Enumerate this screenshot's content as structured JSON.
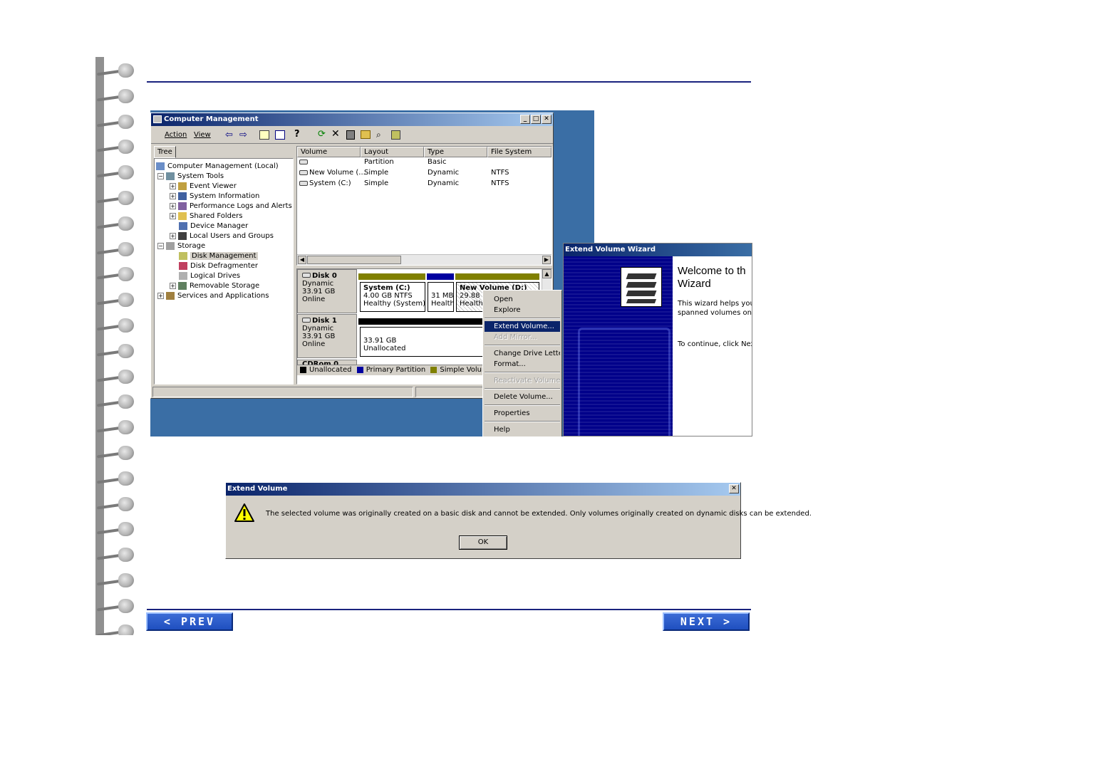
{
  "nav": {
    "prev_label": "< PREV",
    "next_label": "NEXT >"
  },
  "computer_management": {
    "title": "Computer Management",
    "menu": [
      "Action",
      "View"
    ],
    "tree_tab": "Tree",
    "tree": [
      "Computer Management (Local)",
      "System Tools",
      "Event Viewer",
      "System Information",
      "Performance Logs and Alerts",
      "Shared Folders",
      "Device Manager",
      "Local Users and Groups",
      "Storage",
      "Disk Management",
      "Disk Defragmenter",
      "Logical Drives",
      "Removable Storage",
      "Services and Applications"
    ],
    "columns": [
      "Volume",
      "Layout",
      "Type",
      "File System"
    ],
    "volumes": [
      {
        "volume": "",
        "layout": "Partition",
        "type": "Basic",
        "fs": ""
      },
      {
        "volume": "New Volume (...",
        "layout": "Simple",
        "type": "Dynamic",
        "fs": "NTFS"
      },
      {
        "volume": "System (C:)",
        "layout": "Simple",
        "type": "Dynamic",
        "fs": "NTFS"
      }
    ],
    "disk0": {
      "name": "Disk 0",
      "kind": "Dynamic",
      "size": "33.91 GB",
      "status": "Online",
      "p1": {
        "name": "System (C:)",
        "size": "4.00 GB NTFS",
        "status": "Healthy (System)"
      },
      "p2": {
        "size": "31 MB",
        "status": "Health"
      },
      "p3": {
        "name": "New Volume (D:)",
        "size": "29.88 G",
        "status": "Healthy"
      }
    },
    "disk1": {
      "name": "Disk 1",
      "kind": "Dynamic",
      "size": "33.91 GB",
      "status": "Online",
      "p1": {
        "size": "33.91 GB",
        "status": "Unallocated"
      }
    },
    "cdrom": "CDRom 0",
    "legend": [
      "Unallocated",
      "Primary Partition",
      "Simple Volume"
    ],
    "colors": {
      "unallocated": "#000000",
      "primary": "#0000a0",
      "simple": "#808000"
    }
  },
  "context_menu": {
    "items": [
      {
        "label": "Open",
        "enabled": true
      },
      {
        "label": "Explore",
        "enabled": true
      },
      {
        "label": "Extend Volume...",
        "enabled": true,
        "selected": true
      },
      {
        "label": "Add Mirror...",
        "enabled": false
      },
      {
        "label": "Change Drive Letter a",
        "enabled": true
      },
      {
        "label": "Format...",
        "enabled": true
      },
      {
        "label": "Reactivate Volume",
        "enabled": false
      },
      {
        "label": "Delete Volume...",
        "enabled": true
      },
      {
        "label": "Properties",
        "enabled": true
      },
      {
        "label": "Help",
        "enabled": true
      }
    ]
  },
  "wizard": {
    "title": "Extend Volume Wizard",
    "heading_line1": "Welcome to th",
    "heading_line2": "Wizard",
    "body_line1": "This wizard helps you in",
    "body_line2": "spanned volumes on dy",
    "continue": "To continue, click Next."
  },
  "dialog": {
    "title": "Extend Volume",
    "message": "The selected volume was originally created on a basic disk and cannot be extended. Only volumes originally created on dynamic disks can be extended.",
    "ok_label": "OK",
    "close_glyph": "✕"
  }
}
